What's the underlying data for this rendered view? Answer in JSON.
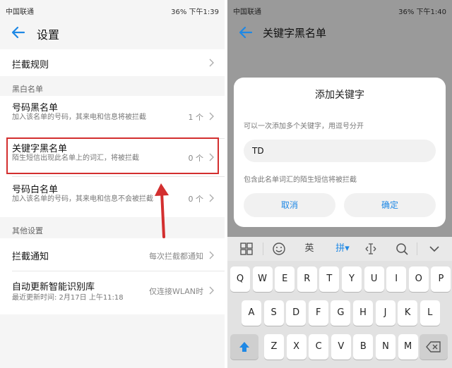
{
  "left": {
    "status": {
      "carrier": "中国联通",
      "right": "36% 下午1:39"
    },
    "title": "设置",
    "items": {
      "intercept_rules": "拦截规则",
      "section_blackwhite": "黑白名单",
      "number_blacklist": {
        "label": "号码黑名单",
        "desc": "加入该名单的号码，其来电和信息将被拦截",
        "value": "1 个"
      },
      "keyword_blacklist": {
        "label": "关键字黑名单",
        "desc": "陌生短信出现此名单上的词汇，将被拦截",
        "value": "0 个"
      },
      "number_whitelist": {
        "label": "号码白名单",
        "desc": "加入该名单的号码，其来电和信息不会被拦截",
        "value": "0 个"
      },
      "section_other": "其他设置",
      "intercept_notify": {
        "label": "拦截通知",
        "value": "每次拦截都通知"
      },
      "auto_update": {
        "label": "自动更新智能识别库",
        "desc": "最近更新时间: 2月17日 上午11:18",
        "value": "仅连接WLAN时"
      }
    }
  },
  "right": {
    "status": {
      "carrier": "中国联通",
      "right": "36% 下午1:40"
    },
    "title": "关键字黑名单",
    "dialog": {
      "title": "添加关键字",
      "hint": "可以一次添加多个关键字，用逗号分开",
      "input_value": "TD",
      "note": "包含此名单词汇的陌生短信将被拦截",
      "cancel": "取消",
      "confirm": "确定"
    },
    "keyboard": {
      "toolbar": {
        "english": "英",
        "pinyin": "拼"
      },
      "row1": [
        "Q",
        "W",
        "E",
        "R",
        "T",
        "Y",
        "U",
        "I",
        "O",
        "P"
      ],
      "row2": [
        "A",
        "S",
        "D",
        "F",
        "G",
        "H",
        "J",
        "K",
        "L"
      ],
      "row3": [
        "Z",
        "X",
        "C",
        "V",
        "B",
        "N",
        "M"
      ]
    }
  },
  "colors": {
    "accent": "#1e88e5",
    "highlight": "#d32f2f"
  }
}
